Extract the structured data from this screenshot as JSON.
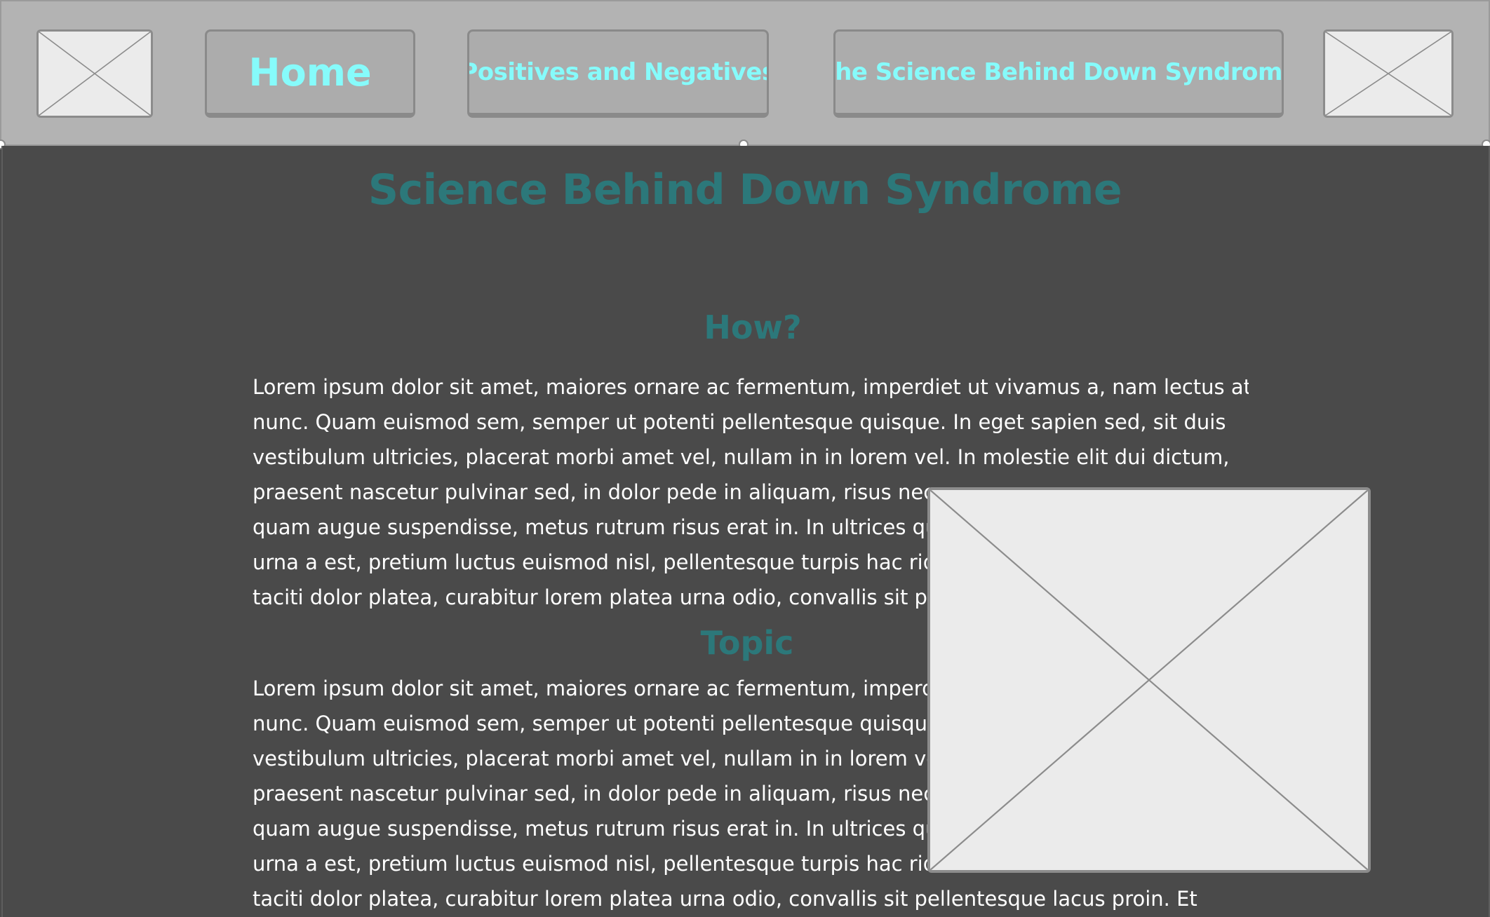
{
  "header": {
    "nav": [
      {
        "label": "Home"
      },
      {
        "label": "Positives and Negatives"
      },
      {
        "label": "The Science Behind Down Syndrome"
      }
    ]
  },
  "main": {
    "title": "Science Behind Down Syndrome",
    "sections": [
      {
        "heading": "How?",
        "lines": [
          "Lorem ipsum dolor sit amet, maiores ornare ac fermentum, imperdiet ut vivamus a, nam lectus at",
          "nunc. Quam euismod sem, semper ut potenti pellentesque quisque. In eget sapien sed, sit duis",
          "vestibulum ultricies, placerat morbi amet vel, nullam in in lorem vel. In molestie elit dui dictum,",
          "praesent nascetur pulvinar sed, in dolor pede in aliquam, risus nec",
          "quam augue suspendisse, metus rutrum risus erat in.  In ultrices qu",
          "urna a est, pretium luctus euismod nisl, pellentesque turpis hac rid",
          "taciti dolor platea, curabitur lorem platea urna odio, convallis sit pe"
        ]
      },
      {
        "heading": "Topic",
        "lines": [
          "Lorem ipsum dolor sit amet, maiores ornare ac fermentum, imperd",
          "nunc. Quam euismod sem, semper ut potenti pellentesque quisque",
          "vestibulum ultricies, placerat morbi amet vel, nullam in in lorem ve",
          "praesent nascetur pulvinar sed, in dolor pede in aliquam, risus nec",
          "quam augue suspendisse, metus rutrum risus erat in.  In ultrices qu",
          "urna a est, pretium luctus euismod nisl, pellentesque turpis hac rid",
          "taciti dolor platea, curabitur lorem platea urna odio, convallis sit pellentesque lacus proin. Et"
        ]
      }
    ]
  },
  "colors": {
    "header_bg": "#b3b3b3",
    "nav_text": "#86fbfb",
    "heading": "#2c787a",
    "body_bg": "#4a4a4a",
    "body_text": "#ffffff"
  },
  "icons": [
    "image-placeholder-icon"
  ]
}
